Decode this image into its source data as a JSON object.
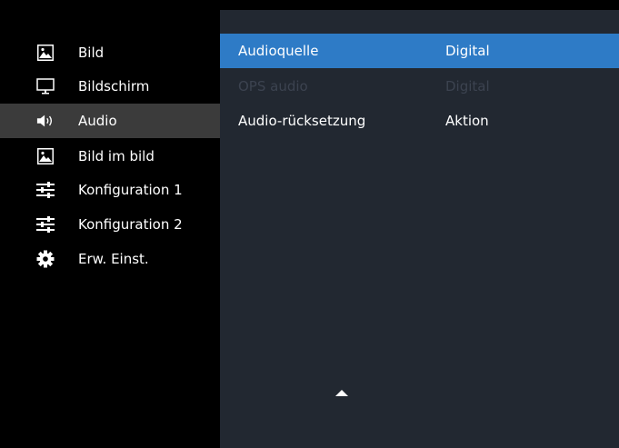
{
  "sidebar": {
    "items": [
      {
        "label": "Bild",
        "icon": "picture-icon"
      },
      {
        "label": "Bildschirm",
        "icon": "monitor-icon"
      },
      {
        "label": "Audio",
        "icon": "speaker-icon",
        "active": true
      },
      {
        "label": "Bild im bild",
        "icon": "picture-icon"
      },
      {
        "label": "Konfiguration 1",
        "icon": "sliders-icon"
      },
      {
        "label": "Konfiguration 2",
        "icon": "sliders-icon"
      },
      {
        "label": "Erw. Einst.",
        "icon": "gear-icon"
      }
    ]
  },
  "panel": {
    "rows": [
      {
        "label": "Audioquelle",
        "value": "Digital",
        "state": "selected"
      },
      {
        "label": "OPS audio",
        "value": "Digital",
        "state": "disabled"
      },
      {
        "label": "Audio-rücksetzung",
        "value": "Aktion",
        "state": "normal"
      }
    ],
    "scroll_icon": "scroll-up-arrow-icon"
  },
  "colors": {
    "selected": "#2e7bc6",
    "panel_bg": "#222831",
    "sidebar_active": "#3b3b3b",
    "disabled_text": "#3c4350"
  }
}
